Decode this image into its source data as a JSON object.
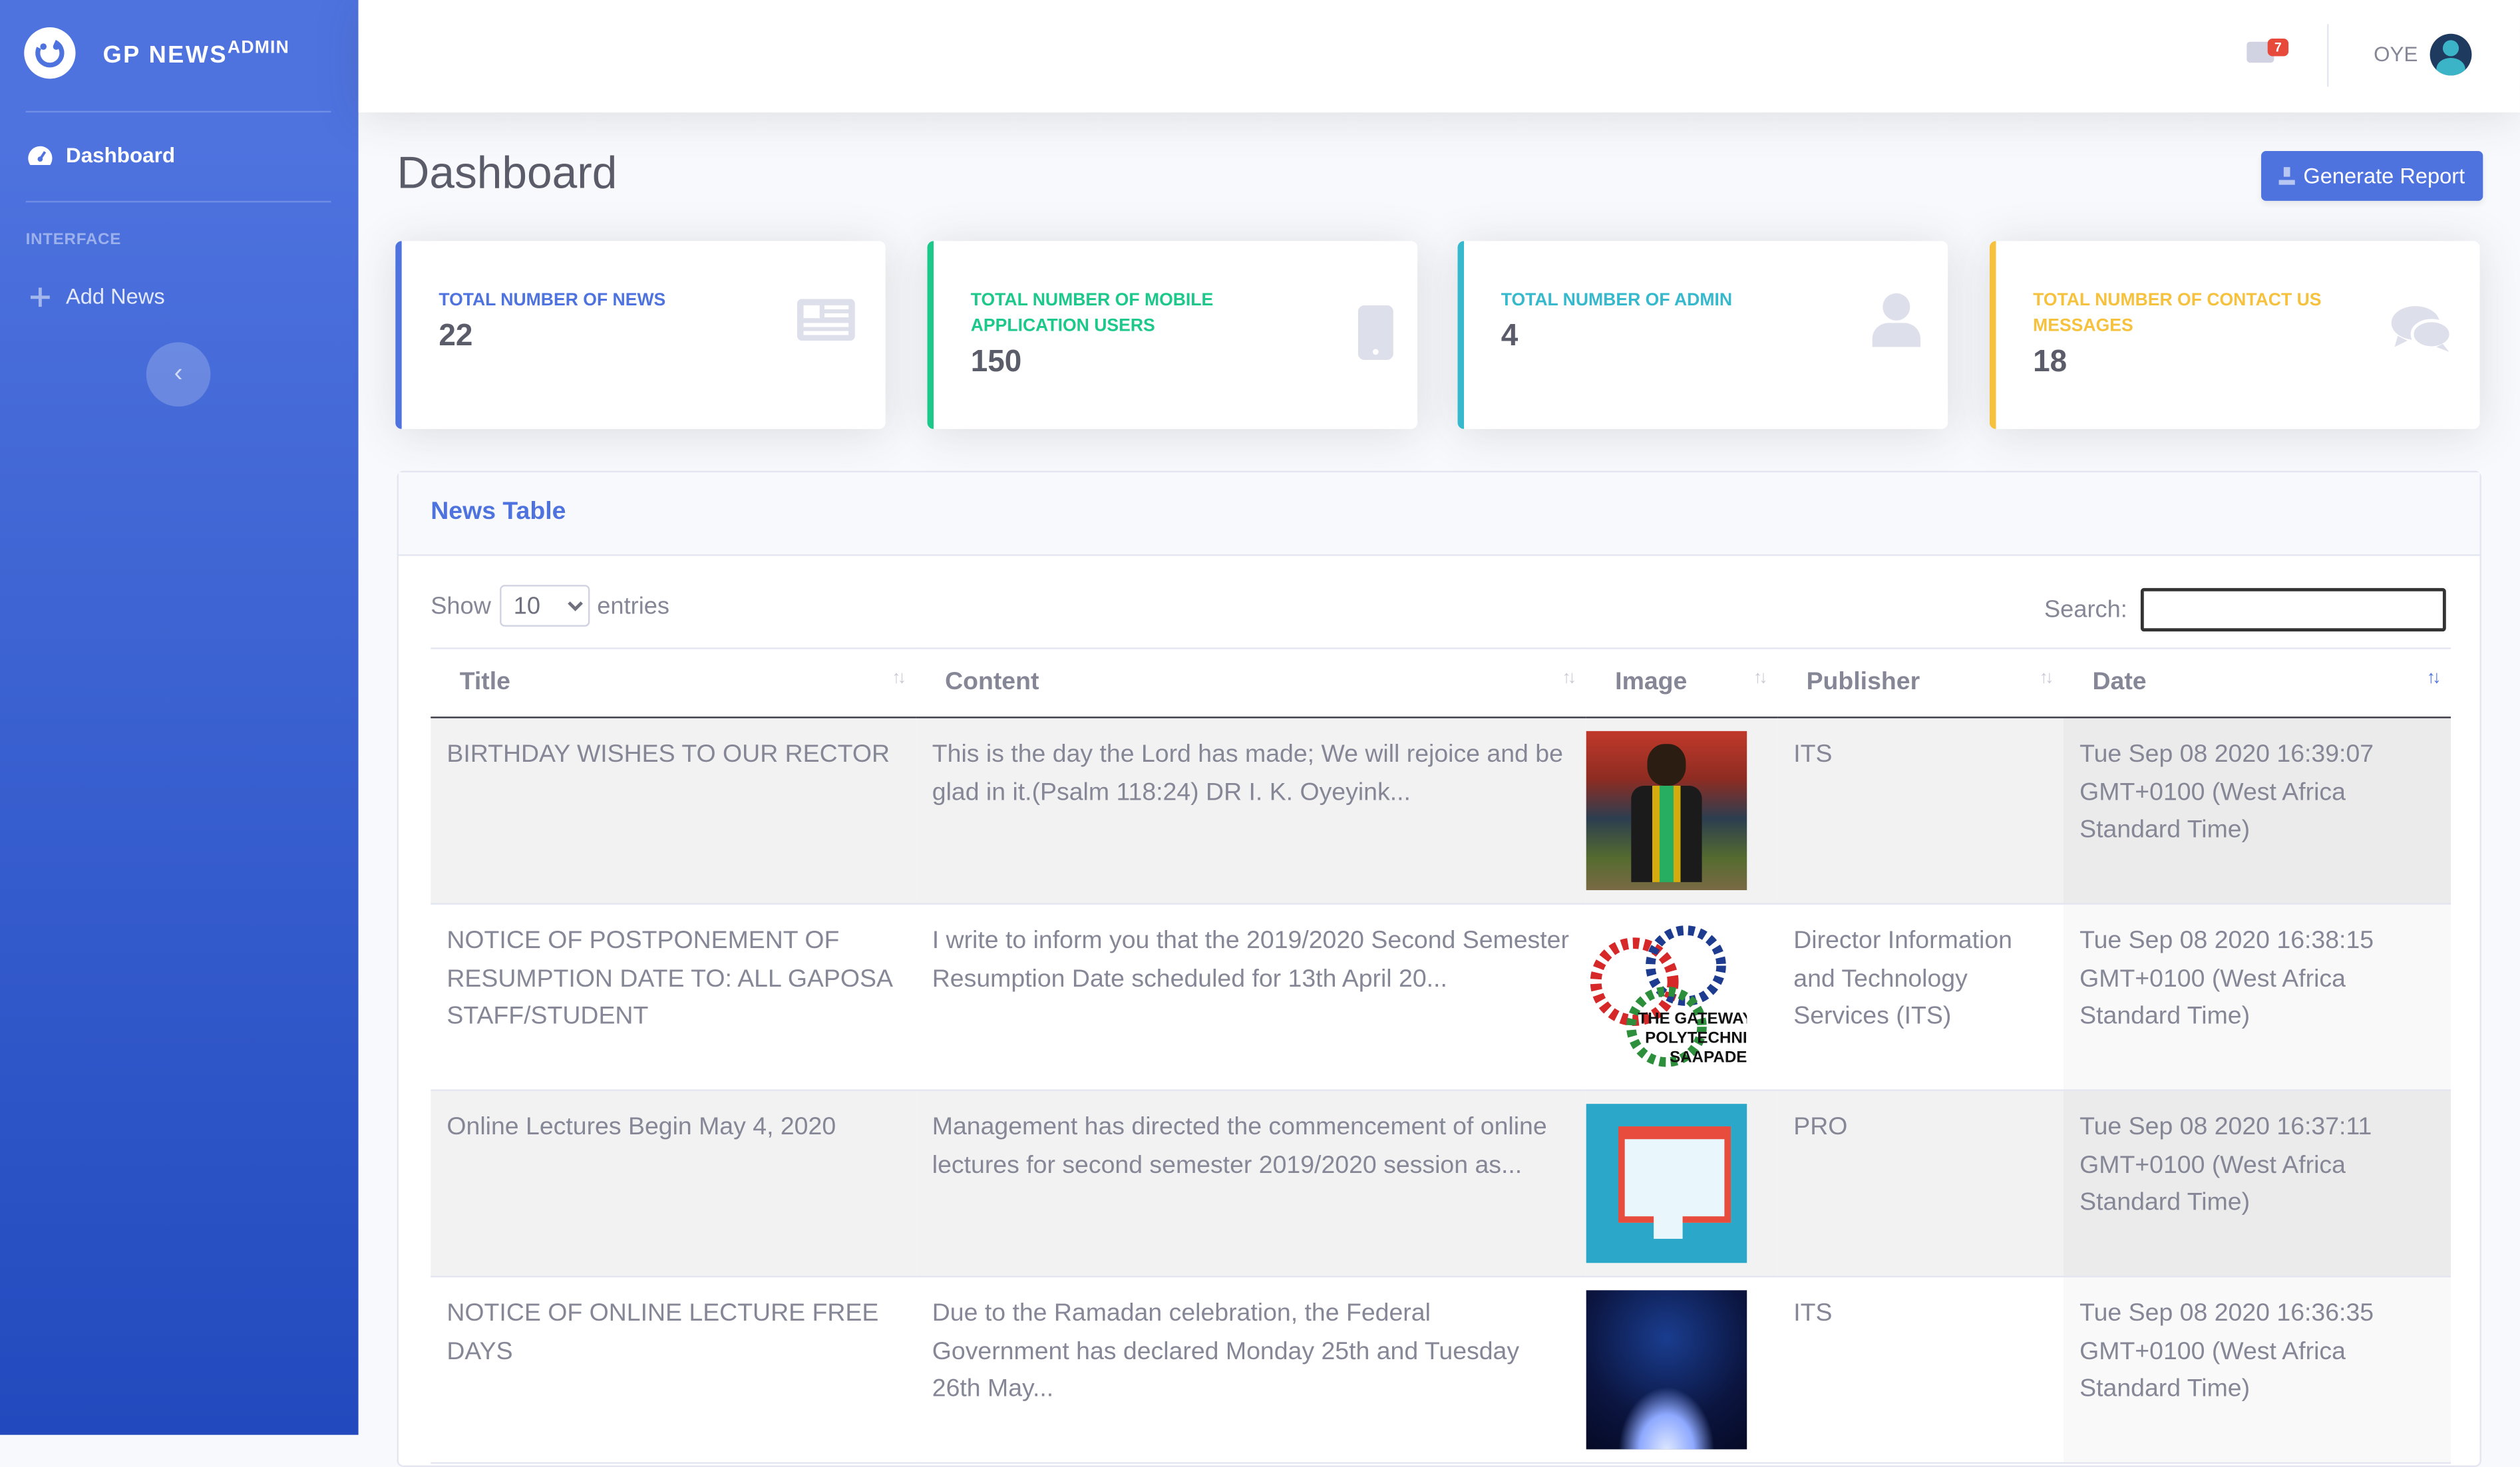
{
  "app": {
    "brand": "GP NEWS",
    "brand_sup": "ADMIN"
  },
  "sidebar": {
    "dashboard_label": "Dashboard",
    "heading": "INTERFACE",
    "add_news_label": "Add News",
    "toggle_icon": "chevron-left-icon"
  },
  "topbar": {
    "messages_count": "7",
    "user_name": "OYE"
  },
  "page": {
    "title": "Dashboard",
    "report_button": "Generate Report"
  },
  "cards": [
    {
      "title": "TOTAL NUMBER OF NEWS",
      "value": "22",
      "icon": "newspaper-icon",
      "color": "#4e73df"
    },
    {
      "title": "TOTAL NUMBER OF MOBILE APPLICATION USERS",
      "value": "150",
      "icon": "mobile-icon",
      "color": "#1cc88a"
    },
    {
      "title": "TOTAL NUMBER OF ADMIN",
      "value": "4",
      "icon": "user-icon",
      "color": "#36b9cc"
    },
    {
      "title": "TOTAL NUMBER OF CONTACT US MESSAGES",
      "value": "18",
      "icon": "comments-icon",
      "color": "#f6c23e"
    }
  ],
  "table": {
    "title": "News Table",
    "show_label": "Show",
    "entries_value": "10",
    "entries_label": "entries",
    "search_label": "Search:",
    "columns": [
      "Title",
      "Content",
      "Image",
      "Publisher",
      "Date"
    ],
    "rows": [
      {
        "title": "BIRTHDAY WISHES TO OUR RECTOR",
        "content": "This is the day the Lord has made; We will rejoice and be glad in it.(Psalm 118:24) DR I. K. Oyeyink...",
        "publisher": "ITS",
        "date": "Tue Sep 08 2020 16:39:07 GMT+0100 (West Africa Standard Time)"
      },
      {
        "title": "NOTICE OF POSTPONEMENT OF RESUMPTION DATE TO: ALL GAPOSA STAFF/STUDENT",
        "content": "I write to inform you that the 2019/2020 Second Semester Resumption Date scheduled for 13th April 20...",
        "publisher": "Director Information and Technology Services (ITS)",
        "date": "Tue Sep 08 2020 16:38:15 GMT+0100 (West Africa Standard Time)",
        "image_text": [
          "THE GATEWAY",
          "POLYTECHNIC",
          "SAAPADE"
        ]
      },
      {
        "title": "Online Lectures Begin May 4, 2020",
        "content": "Management has directed the commencement of online lectures for second semester 2019/2020 session as...",
        "publisher": "PRO",
        "date": "Tue Sep 08 2020 16:37:11 GMT+0100 (West Africa Standard Time)"
      },
      {
        "title": "NOTICE OF ONLINE LECTURE FREE DAYS",
        "content": "Due to the Ramadan celebration, the Federal Government has declared Monday 25th and Tuesday 26th May...",
        "publisher": "ITS",
        "date": "Tue Sep 08 2020 16:36:35 GMT+0100 (West Africa Standard Time)"
      }
    ]
  }
}
